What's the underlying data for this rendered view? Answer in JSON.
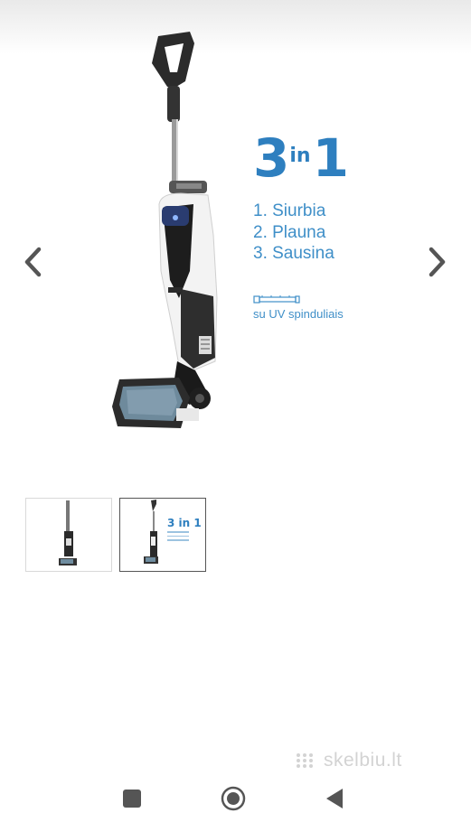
{
  "product_image": {
    "promo_title_big_left": "3",
    "promo_title_small": "in",
    "promo_title_big_right": "1",
    "features": [
      "1. Siurbia",
      "2. Plauna",
      "3. Sausina"
    ],
    "uv_label": "su UV spinduliais"
  },
  "gallery": {
    "thumbnails": [
      {
        "name": "vacuum-photo"
      },
      {
        "name": "vacuum-3in1-promo",
        "selected": true,
        "mini_title": "3 in 1"
      }
    ]
  },
  "watermark": {
    "text": "skelbiu.lt"
  },
  "colors": {
    "accent": "#2e7fbf",
    "arrow": "#555555",
    "navbar_icon": "#555555"
  },
  "android_nav": [
    "recent-apps",
    "home",
    "back"
  ]
}
